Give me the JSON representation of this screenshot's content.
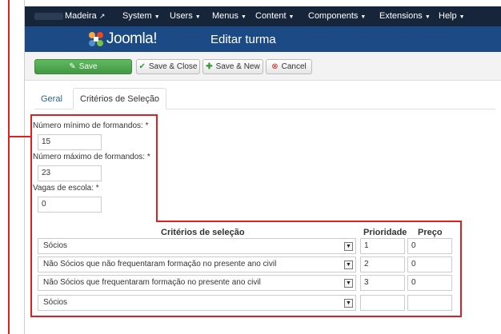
{
  "topnav": {
    "site_label": "Madeira",
    "external_icon": "external-link-icon",
    "menu": [
      "System",
      "Users",
      "Menus",
      "Content",
      "Components",
      "Extensions",
      "Help"
    ]
  },
  "header": {
    "logo_text": "Joomla!",
    "title": "Editar turma"
  },
  "toolbar": {
    "save_label": "Save",
    "save_close_label": "Save & Close",
    "save_new_label": "Save & New",
    "cancel_label": "Cancel"
  },
  "tabs": [
    {
      "label": "Geral",
      "active": false
    },
    {
      "label": "Critérios de Seleção",
      "active": true
    }
  ],
  "form": {
    "min_label": "Número mínimo de formandos: *",
    "min_value": "15",
    "max_label": "Número máximo de formandos: *",
    "max_value": "23",
    "vagas_label": "Vagas de escola: *",
    "vagas_value": "0"
  },
  "criteria_table": {
    "headers": [
      "Critérios de seleção",
      "Prioridade",
      "Preço"
    ],
    "rows": [
      {
        "criterio": "Sócios",
        "prioridade": "1",
        "preco": "0"
      },
      {
        "criterio": "Não Sócios que não frequentaram formação no presente ano civil",
        "prioridade": "2",
        "preco": "0"
      },
      {
        "criterio": "Não Sócios que frequentaram formação no presente ano civil",
        "prioridade": "3",
        "preco": "0"
      },
      {
        "criterio": "Sócios",
        "prioridade": "",
        "preco": ""
      }
    ]
  },
  "colors": {
    "topnav_bg": "#17253b",
    "header_bg": "#1b4a84",
    "save_green": "#4aa24a",
    "highlight_red": "#e02020"
  }
}
